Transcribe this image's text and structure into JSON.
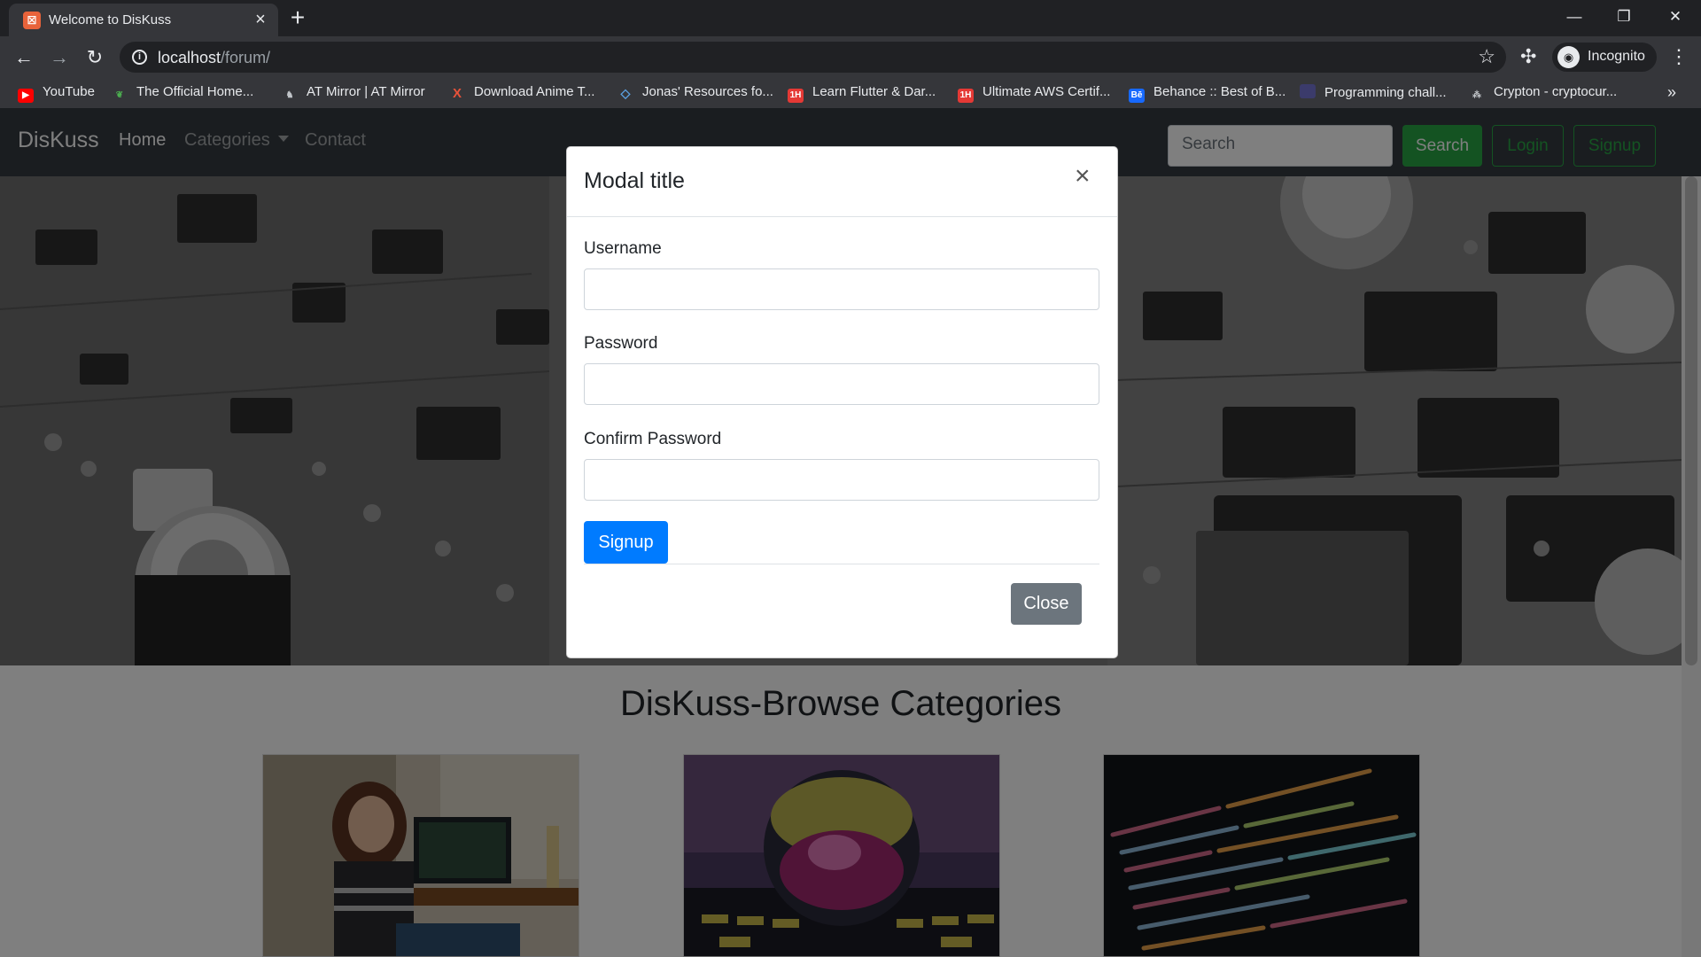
{
  "browser": {
    "tab_title": "Welcome to DisKuss",
    "tab_favicon": "xampp-icon",
    "url_host": "localhost",
    "url_path": "/forum/",
    "profile_label": "Incognito",
    "bookmarks": [
      {
        "label": "YouTube",
        "icon": "youtube-icon",
        "color": "#ff0000"
      },
      {
        "label": "The Official Home...",
        "icon": "leaf-icon",
        "color": "#4caf50"
      },
      {
        "label": "AT Mirror | AT Mirror",
        "icon": "at-mirror-icon",
        "color": "#9aa0a6"
      },
      {
        "label": "Download Anime T...",
        "icon": "x-logo-icon",
        "color": "#e8533a"
      },
      {
        "label": "Jonas' Resources fo...",
        "icon": "diamond-icon",
        "color": "#5aa0e0"
      },
      {
        "label": "Learn Flutter & Dar...",
        "icon": "1h-icon",
        "color": "#e53935"
      },
      {
        "label": "Ultimate AWS Certif...",
        "icon": "1h-icon",
        "color": "#e53935"
      },
      {
        "label": "Behance :: Best of B...",
        "icon": "behance-icon",
        "color": "#1769ff"
      },
      {
        "label": "Programming chall...",
        "icon": "codeforces-icon",
        "color": "#3b3b6b"
      },
      {
        "label": "Crypton - cryptocur...",
        "icon": "crypton-icon",
        "color": "#9aa0a6"
      }
    ]
  },
  "site": {
    "brand": "DisKuss",
    "nav": {
      "home": "Home",
      "categories": "Categories",
      "contact": "Contact"
    },
    "search_placeholder": "Search",
    "search_button": "Search",
    "login_button": "Login",
    "signup_button": "Signup",
    "categories_heading": "DisKuss-Browse Categories"
  },
  "modal": {
    "title": "Modal title",
    "close_symbol": "×",
    "fields": {
      "username_label": "Username",
      "password_label": "Password",
      "confirm_password_label": "Confirm Password"
    },
    "signup_button": "Signup",
    "close_button": "Close"
  },
  "colors": {
    "navbar": "#343a40",
    "primary": "#007bff",
    "success": "#28a745",
    "secondary": "#6c757d"
  }
}
